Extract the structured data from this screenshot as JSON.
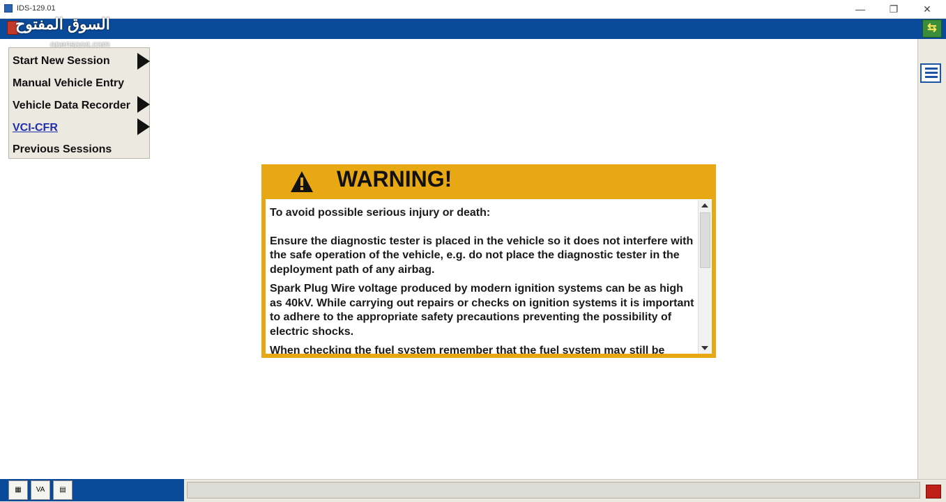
{
  "window": {
    "title": "IDS-129.01",
    "minimize": "—",
    "restore": "❐",
    "close": "✕"
  },
  "watermark": {
    "text": "السوق المفتوح",
    "sub": "opensooq.com"
  },
  "menu": {
    "items": [
      {
        "label": "Start New Session",
        "has_submenu": true
      },
      {
        "label": "Manual Vehicle Entry",
        "has_submenu": false
      },
      {
        "label": "Vehicle Data Recorder",
        "has_submenu": true
      },
      {
        "label": "VCI-CFR",
        "has_submenu": true
      },
      {
        "label": "Previous Sessions",
        "has_submenu": false
      }
    ]
  },
  "warning": {
    "title": "WARNING!",
    "paragraphs": [
      "To avoid possible serious injury or death:",
      "Ensure the diagnostic tester is placed in the vehicle so it does not interfere with the safe operation of the vehicle, e.g. do not place the diagnostic tester in the deployment path of any airbag.",
      "Spark Plug Wire voltage produced by modern ignition systems can be as high as 40kV. While carrying out repairs or checks on ignition systems it is important to adhere to the appropriate safety precautions preventing the possibility of electric shocks.",
      "When checking the fuel system remember that the fuel system may still be"
    ]
  },
  "icons": {
    "exchange": "exchange-arrows-icon",
    "list": "list-view-icon",
    "warning": "warning-triangle-icon"
  },
  "colors": {
    "app_blue": "#0a4a9a",
    "warning_orange": "#e8a813",
    "menu_bg": "#ece9e0",
    "link": "#1f2fb0"
  }
}
